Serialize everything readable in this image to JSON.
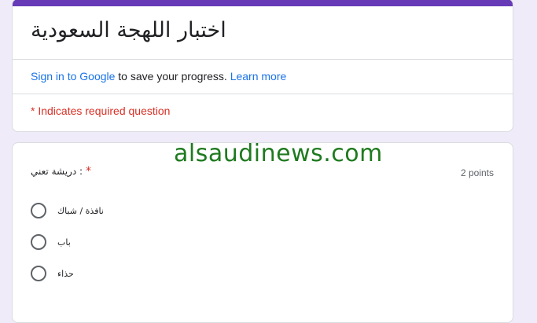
{
  "form": {
    "title": "اختبار اللهجة السعودية",
    "accent_color": "#673ab7",
    "background_color": "#f0ebf8"
  },
  "signin": {
    "link_text": "Sign in to Google",
    "middle_text": " to save your progress. ",
    "learn_more": "Learn more"
  },
  "required_note": "* Indicates required question",
  "question": {
    "title": "دريشة تعني :",
    "required_mark": "*",
    "points": "2 points",
    "options": [
      "نافذة / شباك",
      "باب",
      "حذاء"
    ]
  },
  "watermark": "alsaudinews.com"
}
